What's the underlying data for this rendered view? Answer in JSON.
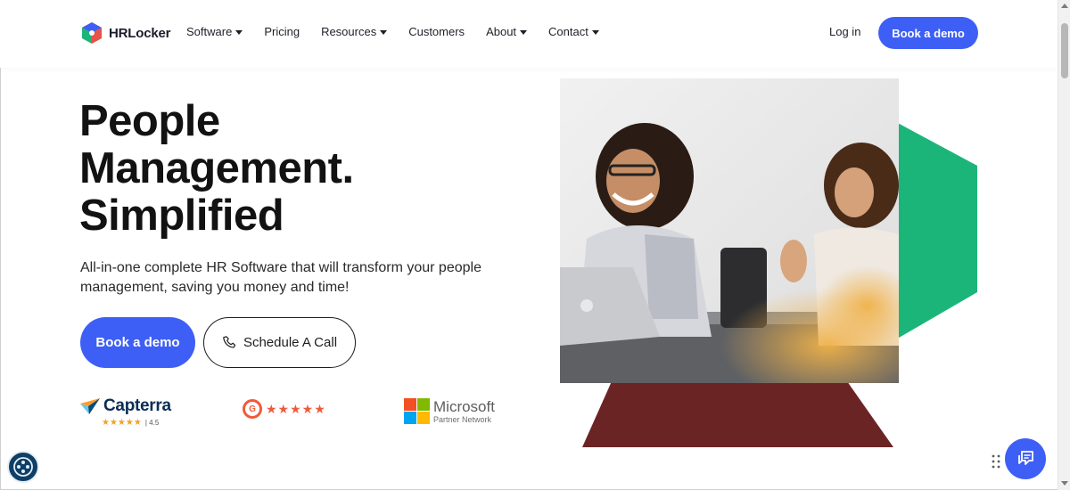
{
  "colors": {
    "accent": "#3e5ff5",
    "green": "#1bb57a",
    "maroon": "#6b2424",
    "text": "#121212"
  },
  "nav": {
    "brand": "HRLocker",
    "items": [
      {
        "label": "Software",
        "has_dropdown": true
      },
      {
        "label": "Pricing",
        "has_dropdown": false
      },
      {
        "label": "Resources",
        "has_dropdown": true
      },
      {
        "label": "Customers",
        "has_dropdown": false
      },
      {
        "label": "About",
        "has_dropdown": true
      },
      {
        "label": "Contact",
        "has_dropdown": true
      }
    ],
    "login": "Log in",
    "cta": "Book a demo"
  },
  "hero": {
    "headline": [
      "People",
      "Management.",
      "Simplified"
    ],
    "subtitle": "All-in-one complete HR Software that will transform your people management, saving you money and time!",
    "primary_button": "Book a demo",
    "secondary_button": "Schedule A Call"
  },
  "badges": {
    "capterra": {
      "name": "Capterra",
      "stars": "★★★★★",
      "score": "4.5"
    },
    "g2": {
      "logo": "G",
      "stars": "★★★★★"
    },
    "microsoft": {
      "title": "Microsoft",
      "subtitle": "Partner Network"
    }
  },
  "icons": {
    "phone": "phone-icon",
    "chat": "chat-icon",
    "accessibility": "accessibility-icon",
    "drag": "drag-handle-icon"
  }
}
